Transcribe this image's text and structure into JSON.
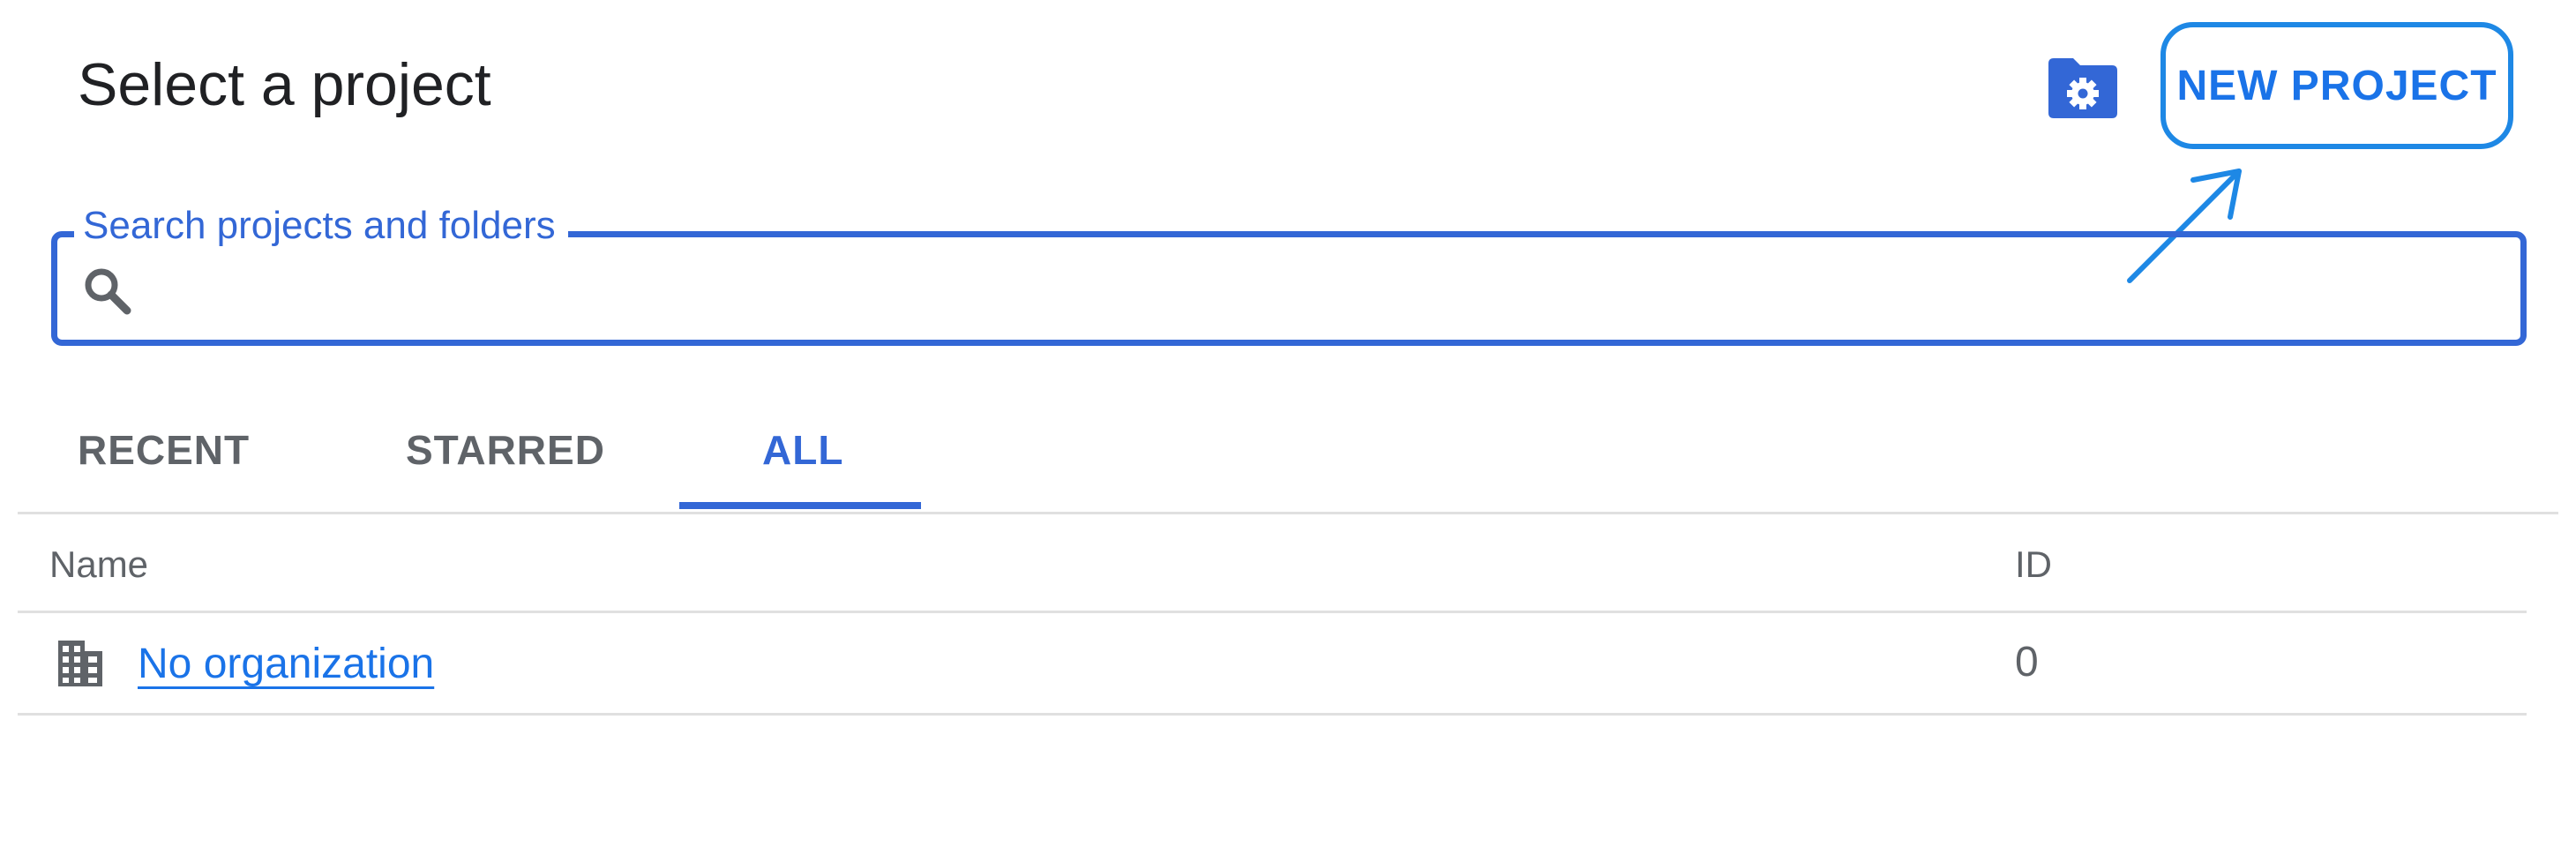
{
  "dialog": {
    "title": "Select a project"
  },
  "toolbar": {
    "manage_icon": "folder-settings-icon",
    "new_project_label": "NEW PROJECT"
  },
  "search": {
    "label": "Search projects and folders",
    "value": "",
    "icon": "search-icon"
  },
  "tabs": [
    {
      "label": "RECENT",
      "active": false
    },
    {
      "label": "STARRED",
      "active": false
    },
    {
      "label": "ALL",
      "active": true
    }
  ],
  "table": {
    "columns": [
      "Name",
      "ID"
    ],
    "rows": [
      {
        "icon": "building-icon",
        "name": "No organization",
        "id": "0"
      }
    ]
  },
  "annotation": {
    "color": "#1e88e5",
    "target": "new-project-button"
  },
  "colors": {
    "accent": "#1a73e8",
    "search_border": "#3367d6",
    "text_primary": "#202124",
    "text_secondary": "#5f6368",
    "divider": "#e0e0e0"
  }
}
